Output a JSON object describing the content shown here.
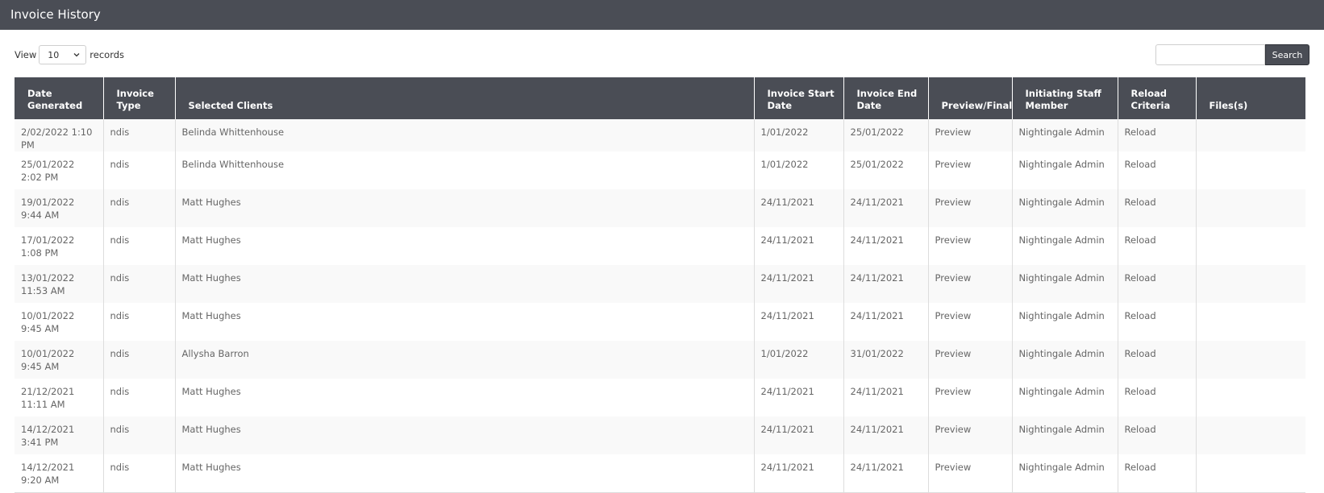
{
  "page": {
    "title": "Invoice History"
  },
  "controls": {
    "view_label": "View",
    "page_size": "10",
    "records_label": "records",
    "search_placeholder": "",
    "search_button": "Search"
  },
  "table": {
    "headers": [
      "Date Generated",
      "Invoice Type",
      "Selected Clients",
      "Invoice Start Date",
      "Invoice End Date",
      "Preview/Final",
      "Initiating Staff Member",
      "Reload Criteria",
      "Files(s)"
    ],
    "rows": [
      [
        "2/02/2022 1:10 PM",
        "ndis",
        "Belinda Whittenhouse",
        "1/01/2022",
        "25/01/2022",
        "Preview",
        "Nightingale Admin",
        "Reload",
        ""
      ],
      [
        "25/01/2022 2:02 PM",
        "ndis",
        "Belinda Whittenhouse",
        "1/01/2022",
        "25/01/2022",
        "Preview",
        "Nightingale Admin",
        "Reload",
        ""
      ],
      [
        "19/01/2022 9:44 AM",
        "ndis",
        "Matt Hughes",
        "24/11/2021",
        "24/11/2021",
        "Preview",
        "Nightingale Admin",
        "Reload",
        ""
      ],
      [
        "17/01/2022 1:08 PM",
        "ndis",
        "Matt Hughes",
        "24/11/2021",
        "24/11/2021",
        "Preview",
        "Nightingale Admin",
        "Reload",
        ""
      ],
      [
        "13/01/2022 11:53 AM",
        "ndis",
        "Matt Hughes",
        "24/11/2021",
        "24/11/2021",
        "Preview",
        "Nightingale Admin",
        "Reload",
        ""
      ],
      [
        "10/01/2022 9:45 AM",
        "ndis",
        "Matt Hughes",
        "24/11/2021",
        "24/11/2021",
        "Preview",
        "Nightingale Admin",
        "Reload",
        ""
      ],
      [
        "10/01/2022 9:45 AM",
        "ndis",
        "Allysha Barron",
        "1/01/2022",
        "31/01/2022",
        "Preview",
        "Nightingale Admin",
        "Reload",
        ""
      ],
      [
        "21/12/2021 11:11 AM",
        "ndis",
        "Matt Hughes",
        "24/11/2021",
        "24/11/2021",
        "Preview",
        "Nightingale Admin",
        "Reload",
        ""
      ],
      [
        "14/12/2021 3:41 PM",
        "ndis",
        "Matt Hughes",
        "24/11/2021",
        "24/11/2021",
        "Preview",
        "Nightingale Admin",
        "Reload",
        ""
      ],
      [
        "14/12/2021 9:20 AM",
        "ndis",
        "Matt Hughes",
        "24/11/2021",
        "24/11/2021",
        "Preview",
        "Nightingale Admin",
        "Reload",
        ""
      ]
    ]
  },
  "colors": {
    "header_bg": "#4a4d55",
    "header_text": "#ffffff",
    "row_alt": "#f9f9f9",
    "cell_text": "#666666"
  },
  "icons": {
    "page_size_select": "chevron-down-icon"
  }
}
